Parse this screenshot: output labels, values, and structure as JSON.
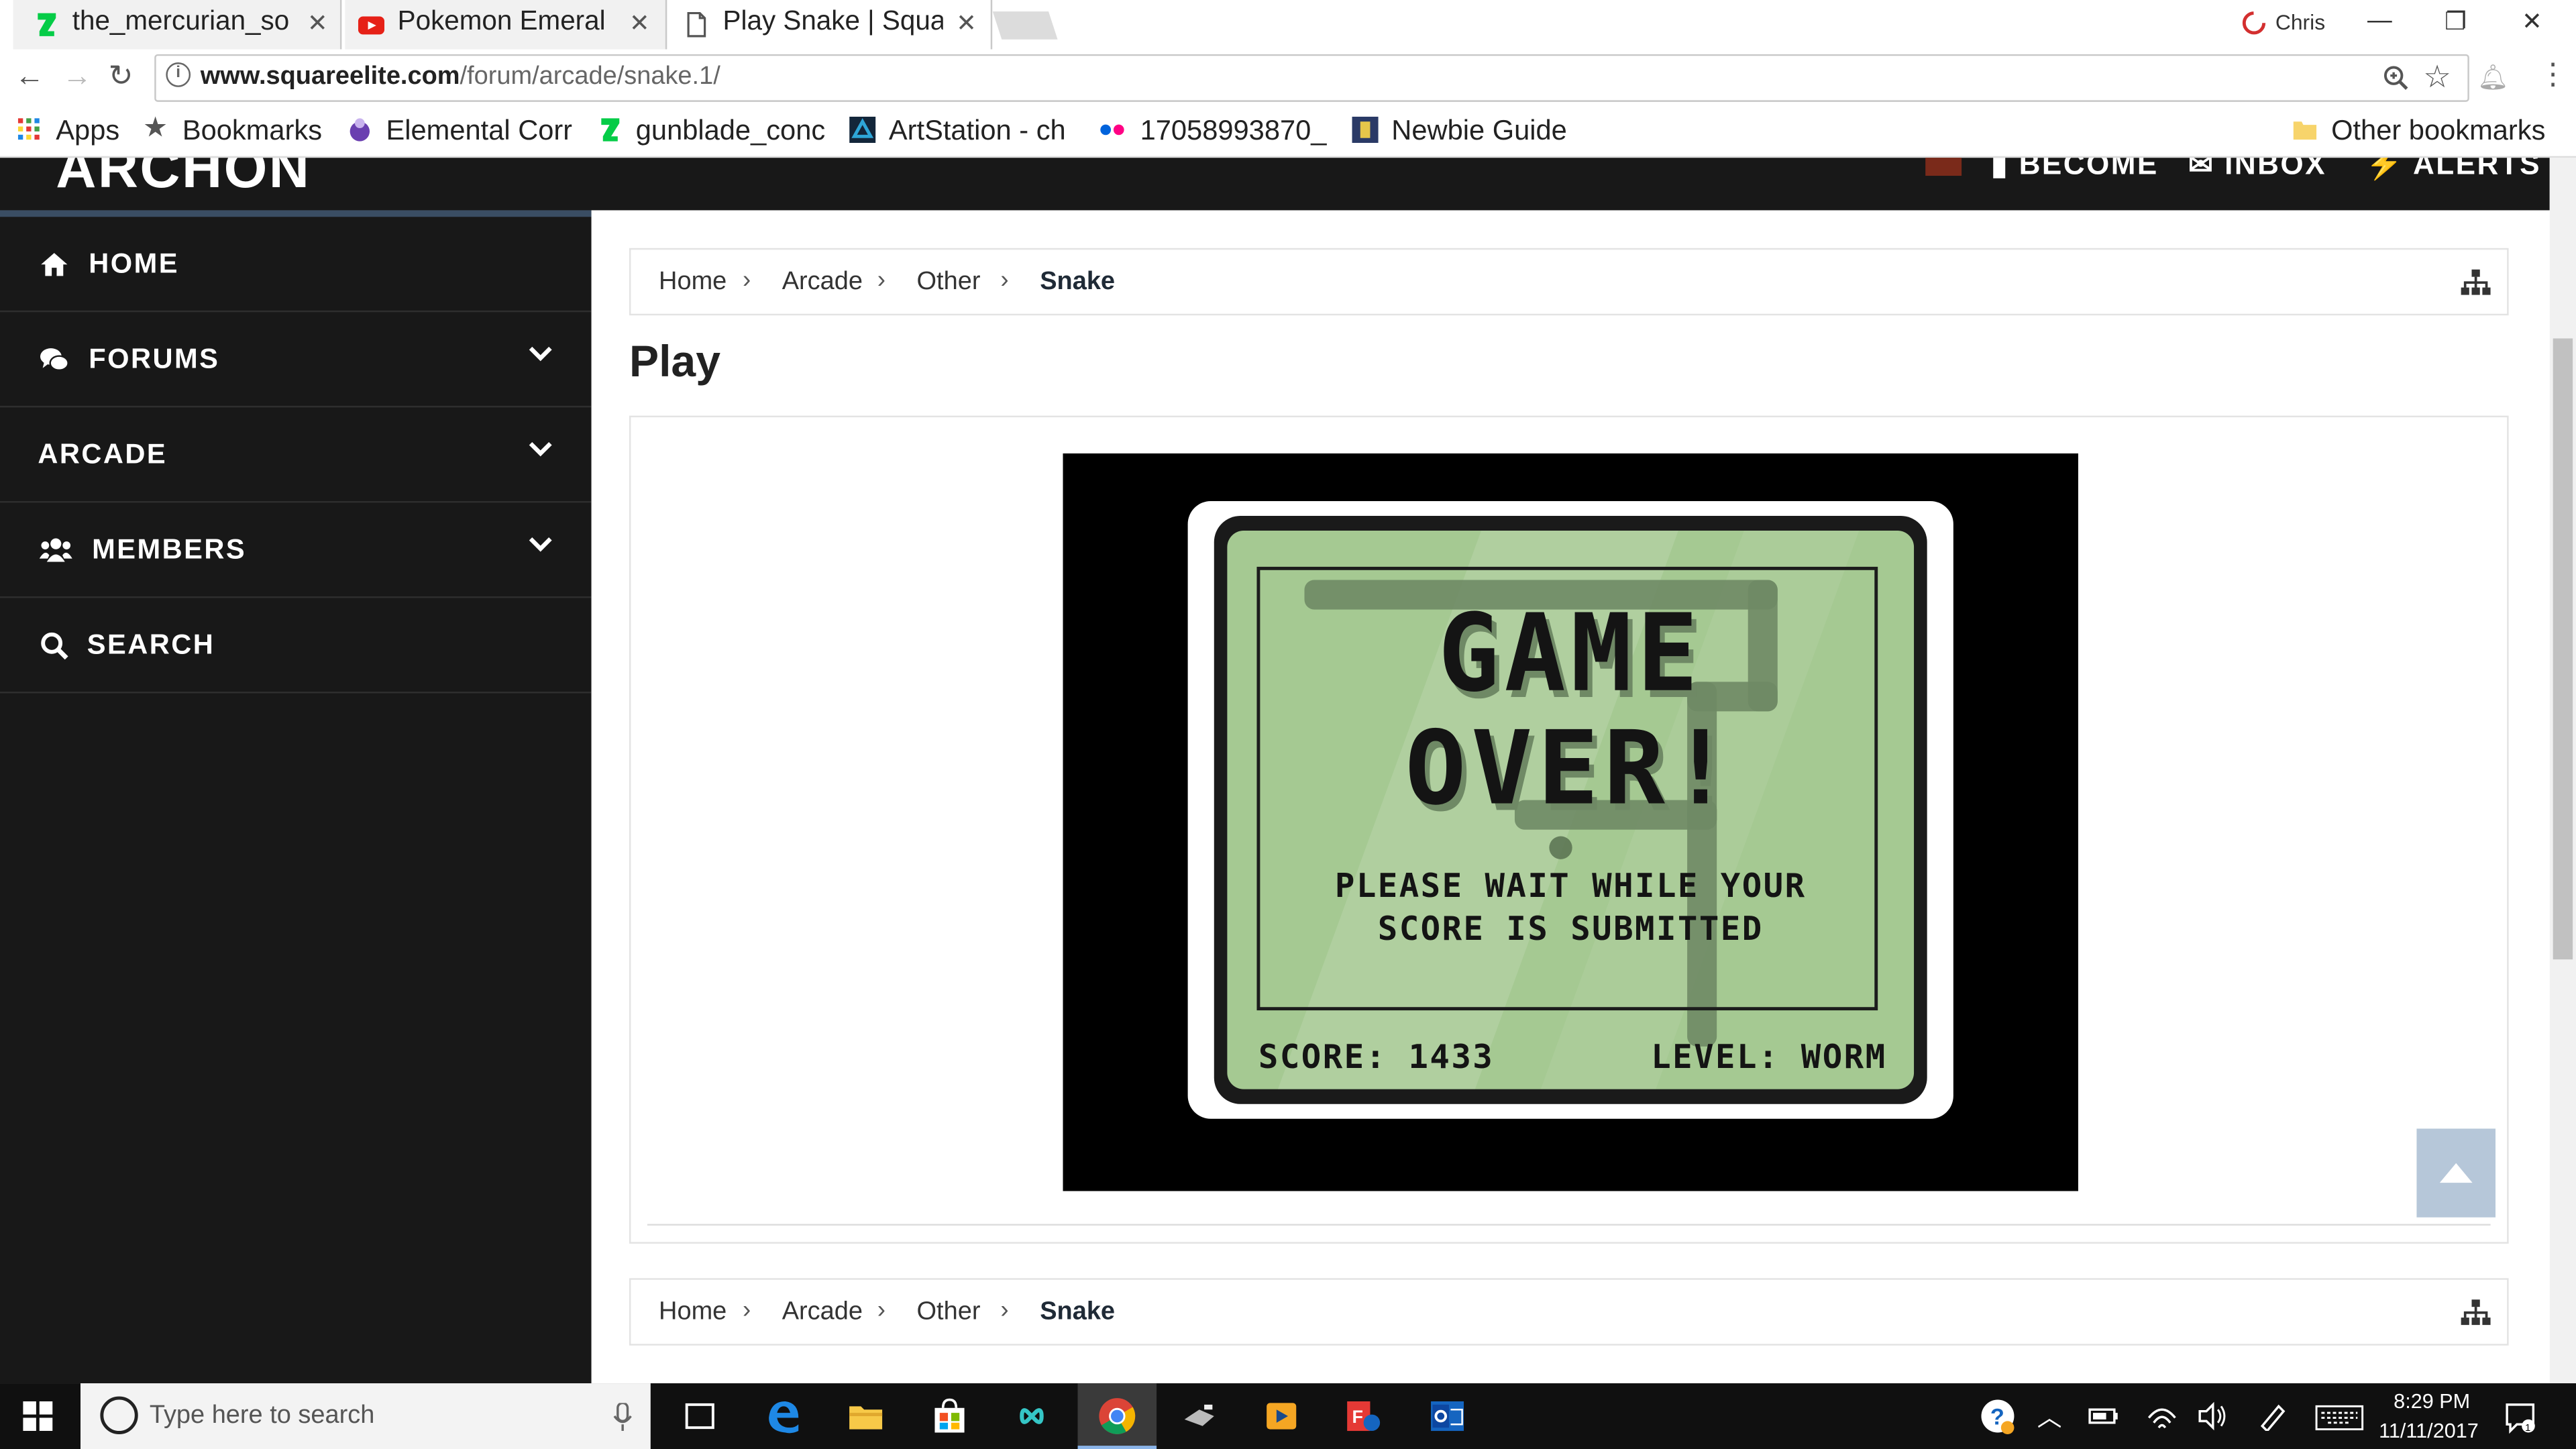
{
  "browser": {
    "tabs": [
      {
        "title": "the_mercurian_so",
        "active": false
      },
      {
        "title": "Pokemon Emeral",
        "active": false
      },
      {
        "title": "Play Snake | Squa",
        "active": true
      }
    ],
    "profile_name": "Chris",
    "url_host": "www.squareelite.com",
    "url_path": "/forum/arcade/snake.1/",
    "bookmarks": [
      "Apps",
      "Bookmarks",
      "Elemental Corr",
      "gunblade_conc",
      "ArtStation - ch",
      "17058993870_",
      "Newbie Guide",
      "Other bookmarks"
    ]
  },
  "site": {
    "logo": "ARCHON",
    "topnav": [
      "BECOME",
      "INBOX",
      "ALERTS"
    ],
    "sidebar": [
      {
        "label": "HOME",
        "icon": "home-icon",
        "has_submenu": false
      },
      {
        "label": "FORUMS",
        "icon": "comments-icon",
        "has_submenu": true
      },
      {
        "label": "ARCADE",
        "icon": "",
        "has_submenu": true
      },
      {
        "label": "MEMBERS",
        "icon": "users-icon",
        "has_submenu": true
      },
      {
        "label": "SEARCH",
        "icon": "search-icon",
        "has_submenu": false
      }
    ],
    "breadcrumb": [
      "Home",
      "Arcade",
      "Other",
      "Snake"
    ],
    "page_title": "Play"
  },
  "game": {
    "line1": "GAME",
    "line2": "OVER!",
    "wait_line1": "PLEASE WAIT WHILE YOUR",
    "wait_line2": "SCORE IS SUBMITTED",
    "score_text": "SCORE: 1433",
    "level_text": "LEVEL: WORM"
  },
  "taskbar": {
    "search_placeholder": "Type here to search",
    "time": "8:29 PM",
    "date": "11/11/2017"
  }
}
